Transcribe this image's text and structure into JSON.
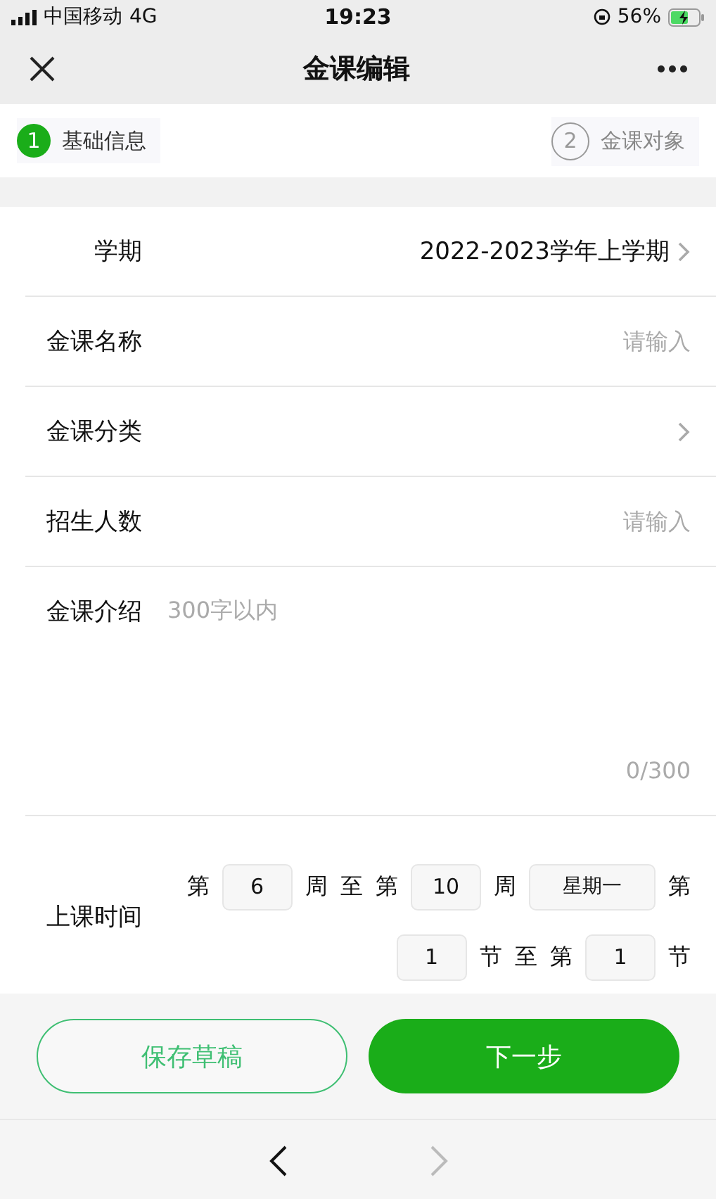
{
  "status_bar": {
    "carrier": "中国移动",
    "network": "4G",
    "time": "19:23",
    "battery": "56%"
  },
  "nav": {
    "title": "金课编辑"
  },
  "steps": [
    {
      "number": "1",
      "label": "基础信息",
      "selected": true
    },
    {
      "number": "2",
      "label": "金课对象",
      "selected": false
    }
  ],
  "fields": [
    {
      "kind": "select",
      "label": "学期",
      "value": "2022-2023学年上学期"
    },
    {
      "kind": "input",
      "label": "金课名称",
      "placeholder": "请输入"
    },
    {
      "kind": "select",
      "label": "金课分类"
    },
    {
      "kind": "input",
      "label": "招生人数",
      "placeholder": "请输入"
    },
    {
      "kind": "textarea",
      "label": "金课介绍",
      "placeholder": "300字以内",
      "counter": "0/300"
    },
    {
      "kind": "schedule",
      "label": "上课时间",
      "lines": [
        [
          {
            "kind": "text",
            "text": "第"
          },
          {
            "kind": "box",
            "value": "6"
          },
          {
            "kind": "text",
            "text": "周 至 第"
          },
          {
            "kind": "box",
            "value": "10"
          },
          {
            "kind": "text",
            "text": "周"
          },
          {
            "kind": "wide-box",
            "value": "星期一"
          },
          {
            "kind": "text",
            "text": "第"
          }
        ],
        [
          {
            "kind": "box",
            "value": "1"
          },
          {
            "kind": "text",
            "text": "节 至 第"
          },
          {
            "kind": "box",
            "value": "1"
          },
          {
            "kind": "text",
            "text": "节"
          }
        ]
      ]
    }
  ],
  "buttons": [
    {
      "kind": "outline",
      "label": "保存草稿"
    },
    {
      "kind": "primary",
      "label": "下一步"
    }
  ],
  "toolbar": {
    "back_disabled": false,
    "forward_disabled": true
  }
}
